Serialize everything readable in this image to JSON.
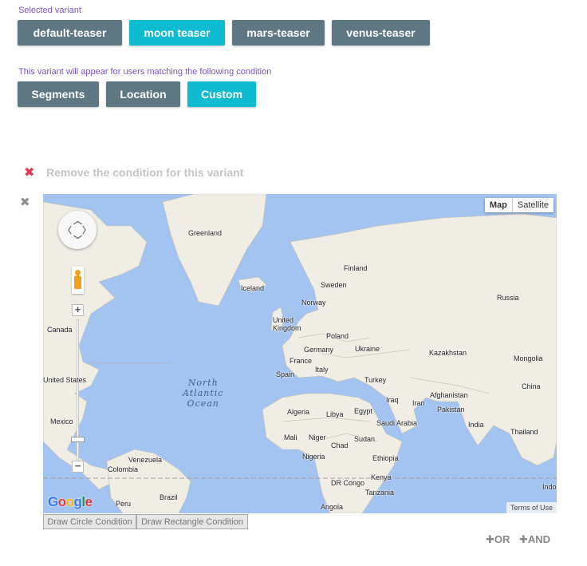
{
  "selected_variant_label": "Selected variant",
  "variants": [
    "default-teaser",
    "moon teaser",
    "mars-teaser",
    "venus-teaser"
  ],
  "condition_label": "This variant will appear for users matching the following condition",
  "condition_tabs": [
    "Segments",
    "Location",
    "Custom"
  ],
  "remove_condition": "Remove the condition for this variant",
  "icons": {
    "remove": "close-icon",
    "close": "close-icon"
  },
  "colors": {
    "accent_cyan": "#0fbbd1",
    "button_gray": "#5e7783",
    "label_purple": "#7b52c8",
    "remove_red": "#e8334a"
  },
  "map": {
    "type_buttons": [
      "Map",
      "Satellite"
    ],
    "ocean_label": [
      "North",
      "Atlantic",
      "Ocean"
    ],
    "places": [
      "Greenland",
      "Finland",
      "Iceland",
      "Sweden",
      "Russia",
      "Norway",
      "United Kingdom",
      "Poland",
      "Canada",
      "Germany",
      "Ukraine",
      "Kazakhstan",
      "France",
      "Mongolia",
      "Italy",
      "Spain",
      "Turkey",
      "United States",
      "China",
      "Afghanistan",
      "Iraq",
      "Iran",
      "Pakistan",
      "Algeria",
      "Libya",
      "Egypt",
      "Saudi Arabia",
      "Mexico",
      "India",
      "Thailand",
      "Mali",
      "Niger",
      "Chad",
      "Sudan",
      "Nigeria",
      "Ethiopia",
      "Venezuela",
      "Colombia",
      "DR Congo",
      "Kenya",
      "Tanzania",
      "Indo",
      "Peru",
      "Brazil",
      "Angola"
    ],
    "google": [
      "G",
      "o",
      "o",
      "g",
      "l",
      "e"
    ],
    "terms": "Terms of Use"
  },
  "draw_buttons": [
    "Draw Circle Condition",
    "Draw Rectangle Condition"
  ],
  "logic": {
    "or": "OR",
    "and": "AND"
  }
}
